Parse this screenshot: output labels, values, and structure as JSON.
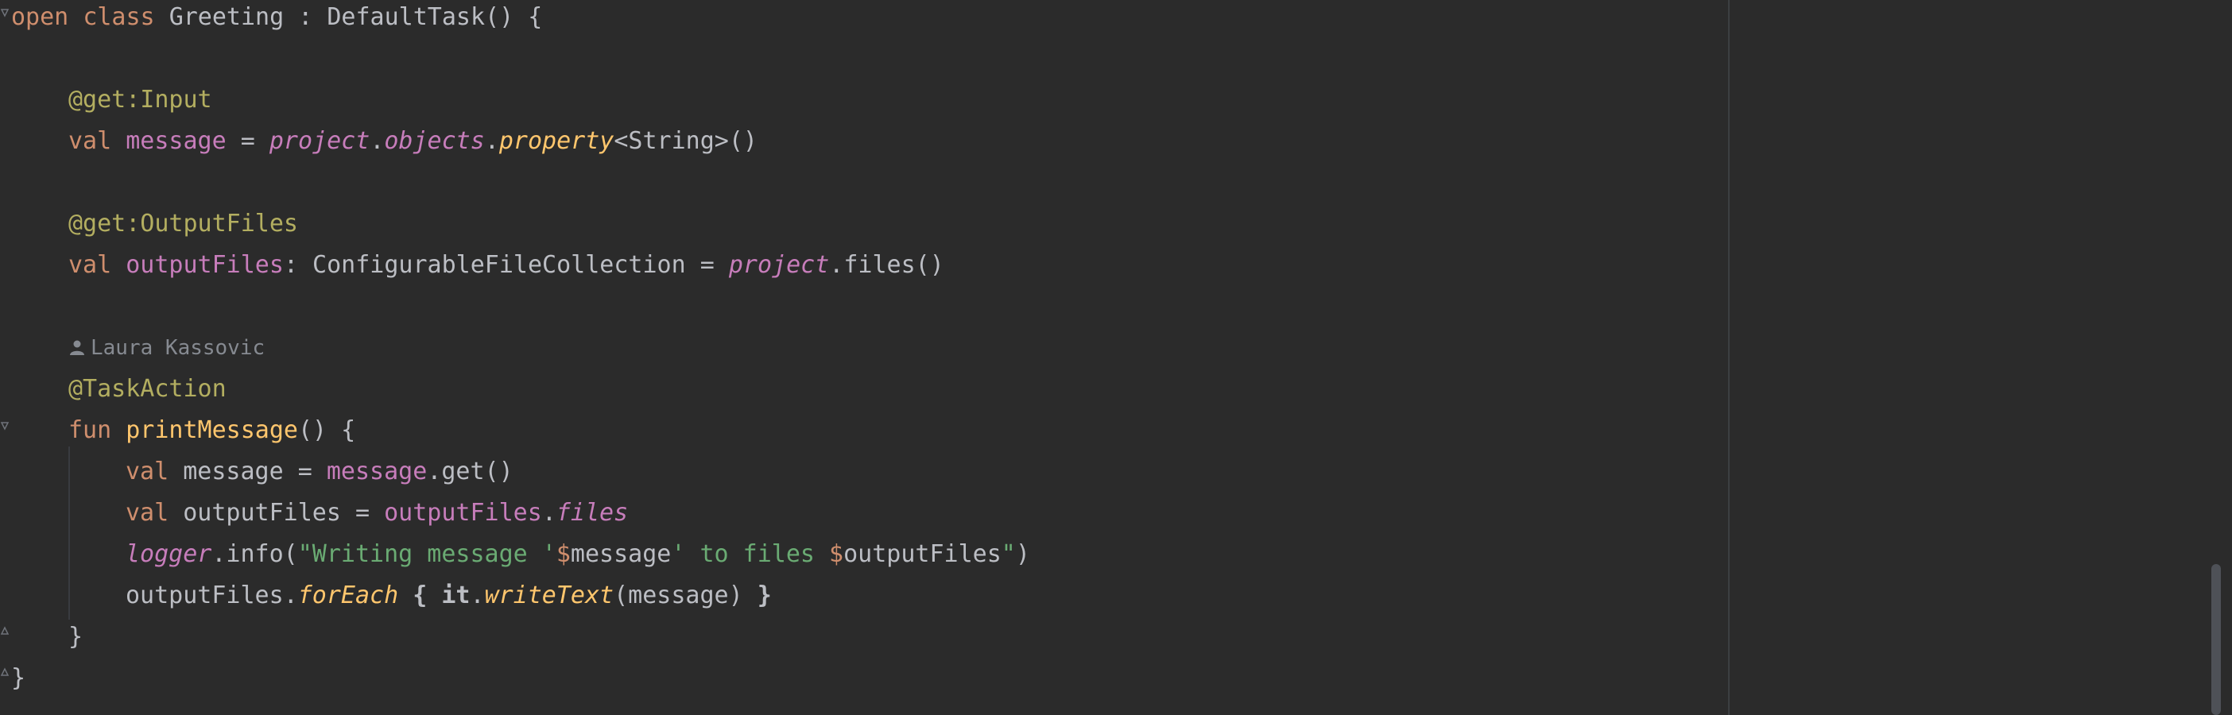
{
  "code": {
    "l1": {
      "open": "open",
      "class": "class",
      "name": "Greeting",
      "colon": " : ",
      "parent": "DefaultTask",
      "tail": "() {"
    },
    "l3": {
      "annotation": "@get:Input"
    },
    "l4": {
      "val": "val",
      "name": "message",
      "eq": " = ",
      "p1": "project",
      "dot1": ".",
      "p2": "objects",
      "dot2": ".",
      "p3": "property",
      "tail": "<String>()"
    },
    "l6": {
      "annotation": "@get:OutputFiles"
    },
    "l7": {
      "val": "val",
      "name": "outputFiles",
      "type": ": ConfigurableFileCollection = ",
      "p1": "project",
      "tail": ".files()"
    },
    "author": {
      "name": "Laura Kassovic"
    },
    "l9": {
      "annotation": "@TaskAction"
    },
    "l10": {
      "fun": "fun",
      "name": "printMessage",
      "tail": "() {"
    },
    "l11": {
      "val": "val",
      "name": "message",
      "eq": " = ",
      "ref": "message",
      "tail": ".get()"
    },
    "l12": {
      "val": "val",
      "name": "outputFiles",
      "eq": " = ",
      "ref": "outputFiles",
      "dot": ".",
      "prop": "files"
    },
    "l13": {
      "logger": "logger",
      "call": ".info(",
      "s1": "\"Writing message '",
      "t1": "$",
      "v1": "message",
      "s2": "' to files ",
      "t2": "$",
      "v2": "outputFiles",
      "s3": "\"",
      "tail": ")"
    },
    "l14": {
      "recv": "outputFiles",
      "dot": ".",
      "ext": "forEach",
      "brace": " { ",
      "it": "it",
      "dot2": ".",
      "call": "writeText",
      "args": "(message)",
      "close": " }"
    },
    "l15": {
      "brace": "}"
    },
    "l16": {
      "brace": "}"
    }
  },
  "colors": {
    "background": "#2b2b2b",
    "keyword": "#cf8e6d",
    "annotation": "#b3ae60",
    "property": "#c77dbb",
    "function": "#ffc66d",
    "string": "#6aab73",
    "text": "#bcbec4"
  },
  "icons": {
    "author": "person-icon",
    "fold": "fold-arrow-icon"
  }
}
